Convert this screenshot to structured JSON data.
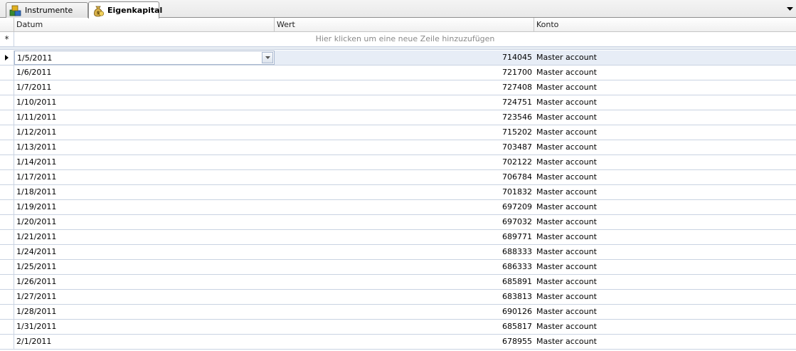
{
  "tabs": [
    {
      "label": "Instrumente",
      "icon": "instruments-cubes-icon",
      "active": false
    },
    {
      "label": "Eigenkapital",
      "icon": "money-bag-icon",
      "active": true
    }
  ],
  "grid": {
    "columns": [
      "Datum",
      "Wert",
      "Konto"
    ],
    "new_row_marker": "*",
    "new_row_hint": "Hier klicken um eine neue Zeile hinzuzufügen",
    "rows": [
      {
        "date": "1/5/2011",
        "value": "714045",
        "account": "Master account"
      },
      {
        "date": "1/6/2011",
        "value": "721700",
        "account": "Master account"
      },
      {
        "date": "1/7/2011",
        "value": "727408",
        "account": "Master account"
      },
      {
        "date": "1/10/2011",
        "value": "724751",
        "account": "Master account"
      },
      {
        "date": "1/11/2011",
        "value": "723546",
        "account": "Master account"
      },
      {
        "date": "1/12/2011",
        "value": "715202",
        "account": "Master account"
      },
      {
        "date": "1/13/2011",
        "value": "703487",
        "account": "Master account"
      },
      {
        "date": "1/14/2011",
        "value": "702122",
        "account": "Master account"
      },
      {
        "date": "1/17/2011",
        "value": "706784",
        "account": "Master account"
      },
      {
        "date": "1/18/2011",
        "value": "701832",
        "account": "Master account"
      },
      {
        "date": "1/19/2011",
        "value": "697209",
        "account": "Master account"
      },
      {
        "date": "1/20/2011",
        "value": "697032",
        "account": "Master account"
      },
      {
        "date": "1/21/2011",
        "value": "689771",
        "account": "Master account"
      },
      {
        "date": "1/24/2011",
        "value": "688333",
        "account": "Master account"
      },
      {
        "date": "1/25/2011",
        "value": "686333",
        "account": "Master account"
      },
      {
        "date": "1/26/2011",
        "value": "685891",
        "account": "Master account"
      },
      {
        "date": "1/27/2011",
        "value": "683813",
        "account": "Master account"
      },
      {
        "date": "1/28/2011",
        "value": "690126",
        "account": "Master account"
      },
      {
        "date": "1/31/2011",
        "value": "685817",
        "account": "Master account"
      },
      {
        "date": "2/1/2011",
        "value": "678955",
        "account": "Master account"
      }
    ]
  },
  "colors": {
    "grid_line": "#c9d3e2",
    "current_row": "#e7edf6",
    "hint_text": "#8a8a8a"
  }
}
